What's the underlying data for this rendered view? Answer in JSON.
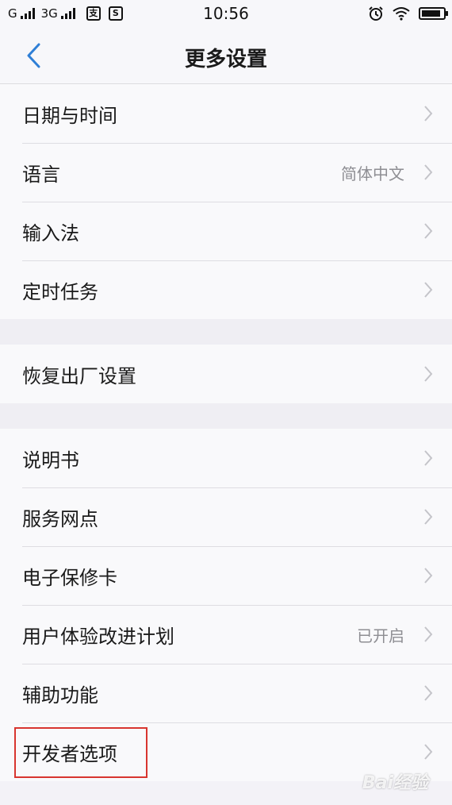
{
  "status_bar": {
    "network_1": "G",
    "network_2": "3G",
    "badge_1": "支",
    "badge_2": "S",
    "time": "10:56",
    "battery_level": 0.9
  },
  "nav": {
    "title": "更多设置"
  },
  "groups": [
    {
      "items": [
        {
          "label": "日期与时间",
          "value": ""
        },
        {
          "label": "语言",
          "value": "简体中文"
        },
        {
          "label": "输入法",
          "value": ""
        },
        {
          "label": "定时任务",
          "value": ""
        }
      ]
    },
    {
      "items": [
        {
          "label": "恢复出厂设置",
          "value": ""
        }
      ]
    },
    {
      "items": [
        {
          "label": "说明书",
          "value": ""
        },
        {
          "label": "服务网点",
          "value": ""
        },
        {
          "label": "电子保修卡",
          "value": ""
        },
        {
          "label": "用户体验改进计划",
          "value": "已开启"
        },
        {
          "label": "辅助功能",
          "value": ""
        },
        {
          "label": "开发者选项",
          "value": ""
        }
      ]
    }
  ],
  "watermark": "Bai经验",
  "colors": {
    "accent": "#2f7fd6",
    "highlight": "#d8352f",
    "secondary_text": "#8e8e93"
  }
}
